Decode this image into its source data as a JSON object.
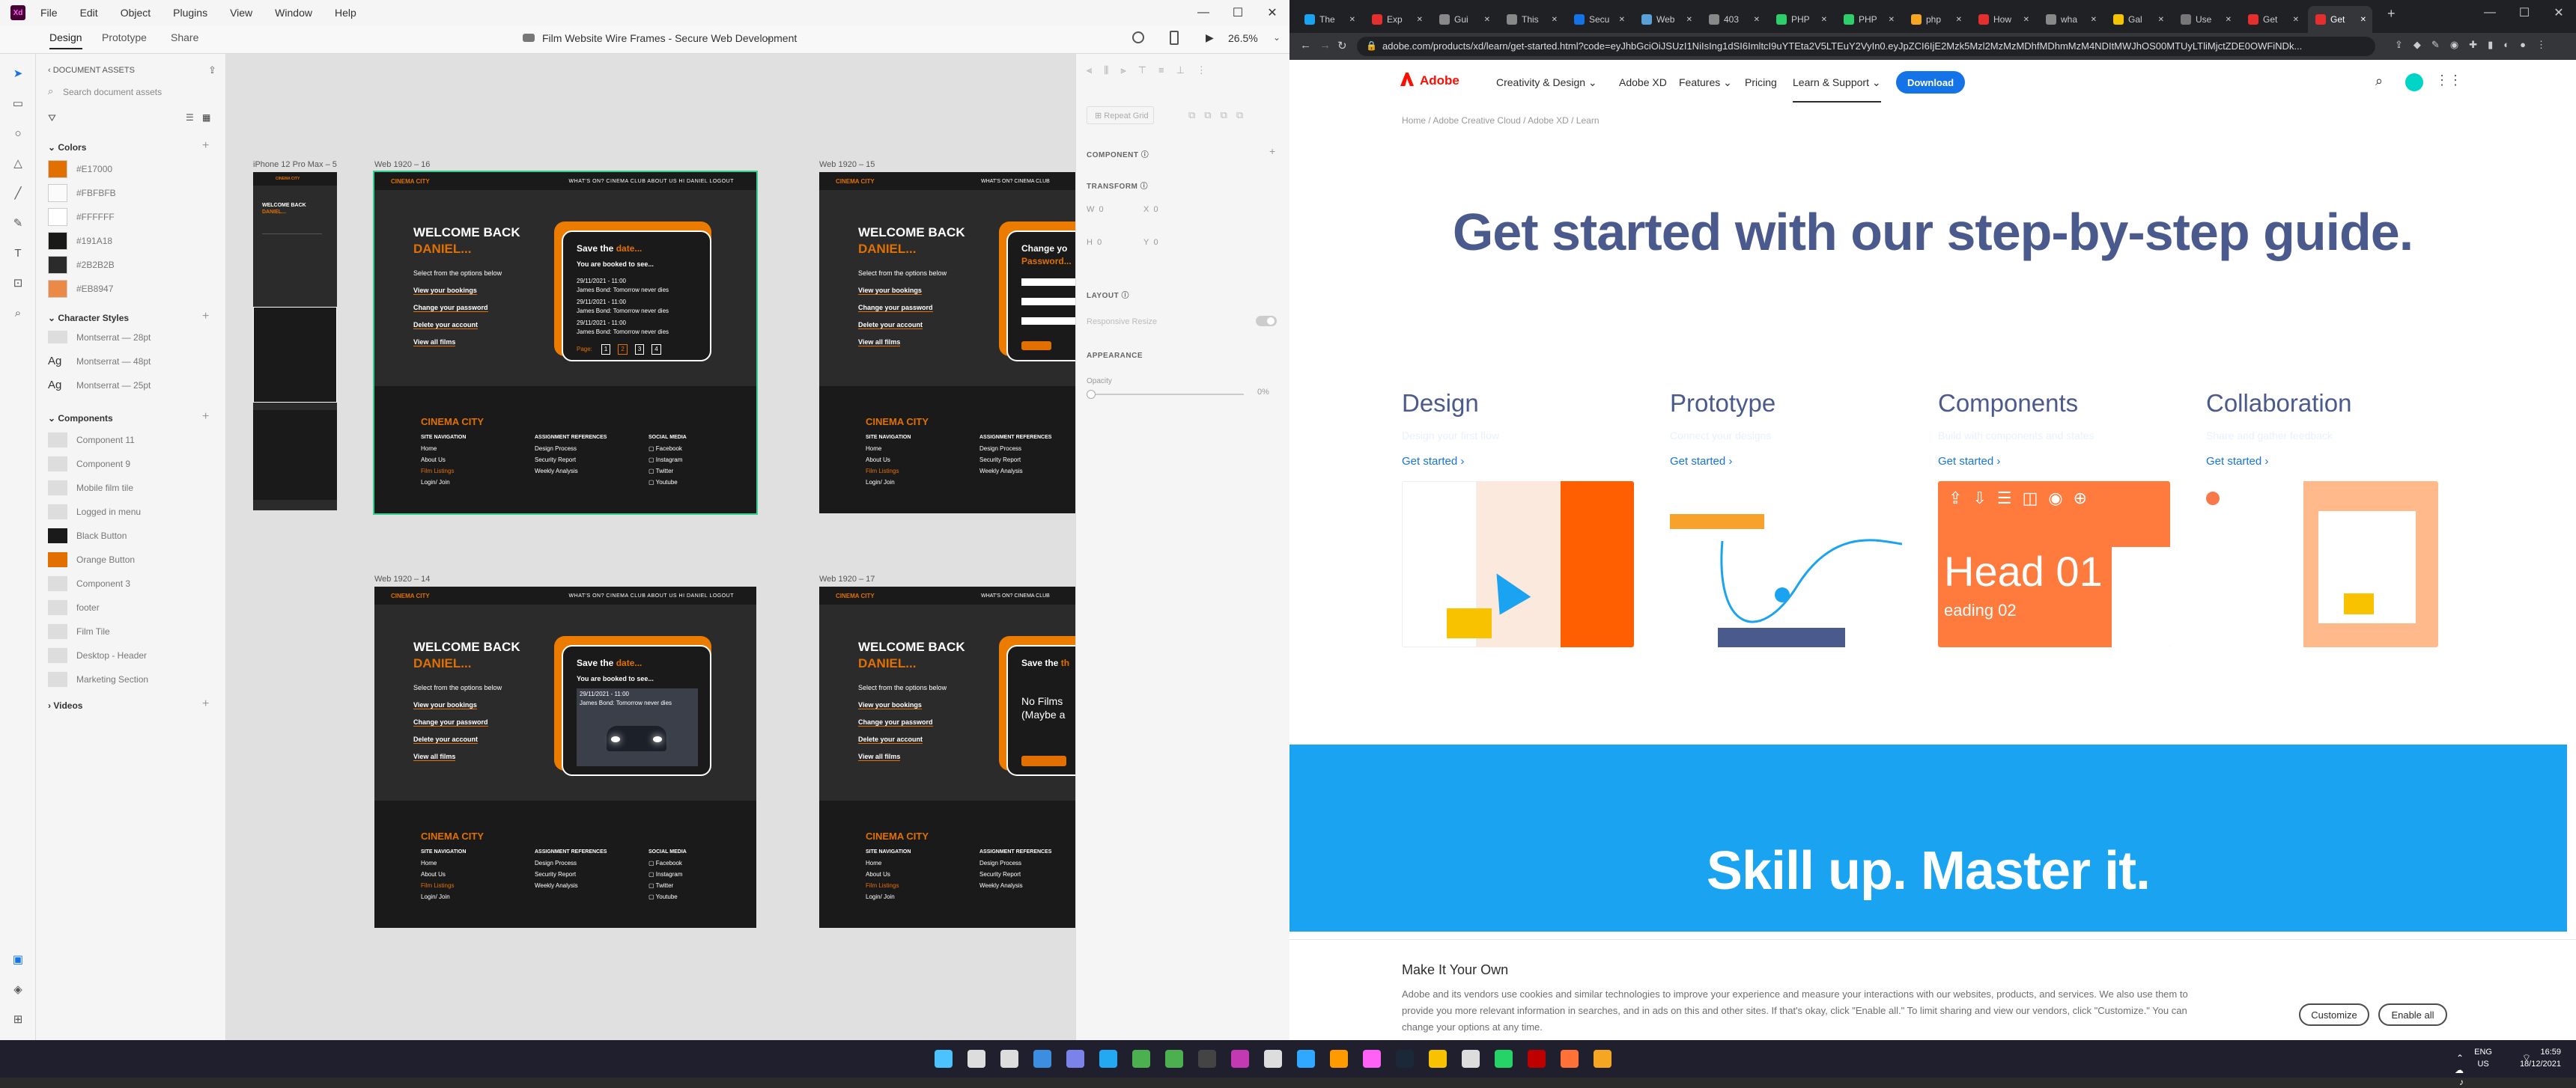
{
  "xd": {
    "menu": [
      "File",
      "Edit",
      "Object",
      "Plugins",
      "View",
      "Window",
      "Help"
    ],
    "tabs": {
      "design": "Design",
      "prototype": "Prototype",
      "share": "Share"
    },
    "doc_title": "Film Website Wire Frames - Secure Web Development",
    "zoom": "26.5%",
    "assets": {
      "header": "DOCUMENT ASSETS",
      "search_placeholder": "Search document assets",
      "colors_head": "Colors",
      "colors": [
        {
          "hex": "#E17000",
          "label": "#E17000"
        },
        {
          "hex": "#FBFBFB",
          "label": "#FBFBFB"
        },
        {
          "hex": "#FFFFFF",
          "label": "#FFFFFF"
        },
        {
          "hex": "#191A18",
          "label": "#191A18"
        },
        {
          "hex": "#2B2B2B",
          "label": "#2B2B2B"
        },
        {
          "hex": "#EB8947",
          "label": "#EB8947"
        }
      ],
      "char_head": "Character Styles",
      "char_styles": [
        "Montserrat — 28pt",
        "Montserrat — 48pt",
        "Montserrat — 25pt"
      ],
      "comp_head": "Components",
      "components": [
        "Component 11",
        "Component 9",
        "Mobile film tile",
        "Logged in menu",
        "Black Button",
        "Orange Button",
        "Component 3",
        "footer",
        "Film Tile",
        "Desktop - Header",
        "Marketing Section"
      ],
      "videos_head": "Videos"
    },
    "artboards": {
      "phone_label": "iPhone 12 Pro Max – 5",
      "ab16": "Web 1920 – 16",
      "ab15": "Web 1920 – 15",
      "ab14": "Web 1920 – 14",
      "ab17": "Web 1920 – 17",
      "logo": "CINEMA CITY",
      "nav_links": "WHAT'S ON?   CINEMA CLUB   ABOUT US   HI DANIEL   LOGOUT",
      "welcome": "WELCOME BACK",
      "name": "DANIEL...",
      "select": "Select from the options below",
      "links": [
        "View your bookings",
        "Change your password",
        "Delete your account",
        "View all films"
      ],
      "save_the": "Save the",
      "date": "date...",
      "booked": "You are booked to see...",
      "film1a": "29/11/2021 - 11:00",
      "film1b": "James Bond: Tomorrow never dies",
      "page": "Page:",
      "pages": [
        "1",
        "2",
        "3",
        "4"
      ],
      "change_pw": "Change yo",
      "password": "Password...",
      "no_films": "No Films",
      "maybe": "(Maybe a",
      "footer_title": "CINEMA CITY",
      "site_nav_head": "SITE NAVIGATION",
      "site_nav": [
        "Home",
        "About Us",
        "Film Listings",
        "Login/ Join"
      ],
      "assign_head": "ASSIGNMENT REFERENCES",
      "assign": [
        "Design Process",
        "Security Report",
        "Weekly Analysis"
      ],
      "social_head": "SOCIAL MEDIA",
      "social": [
        "Facebook",
        "Instagram",
        "Twitter",
        "Youtube"
      ]
    },
    "props": {
      "repeat_grid": "Repeat Grid",
      "component": "COMPONENT",
      "transform": "TRANSFORM",
      "w": "W",
      "w_val": "0",
      "x": "X",
      "x_val": "0",
      "h": "H",
      "h_val": "0",
      "y": "Y",
      "y_val": "0",
      "layout": "LAYOUT",
      "responsive": "Responsive Resize",
      "appearance": "APPEARANCE",
      "opacity": "Opacity",
      "opacity_val": "0%"
    }
  },
  "chrome": {
    "tabs": [
      "The",
      "Exp",
      "Gui",
      "This",
      "Secu",
      "Web",
      "403",
      "PHP",
      "PHP",
      "php",
      "How",
      "wha",
      "Gal",
      "Use",
      "Get",
      "Get"
    ],
    "url": "adobe.com/products/xd/learn/get-started.html?code=eyJhbGciOiJSUzI1NiIsIng1dSI6ImltcI9uYTEta2V5LTEuY2VyIn0.eyJpZCI6IjE2Mzk5Mzl2MzMzMDhfMDhmMzM4NDItMWJhOS00MTUyLTliMjctZDE0OWFiNDk..."
  },
  "adobe": {
    "brand": "Adobe",
    "nav": [
      "Creativity & Design",
      "Adobe XD",
      "Features",
      "Pricing",
      "Learn & Support"
    ],
    "download": "Download",
    "breadcrumb": "Home  /  Adobe Creative Cloud  /  Adobe XD  /  Learn",
    "headline": "Get started with our step-by-step guide.",
    "cards": [
      {
        "title": "Design",
        "desc": "Design your first flow",
        "cta": "Get started"
      },
      {
        "title": "Prototype",
        "desc": "Connect your designs",
        "cta": "Get started"
      },
      {
        "title": "Components",
        "desc": "Build with components and states",
        "cta": "Get started"
      },
      {
        "title": "Collaboration",
        "desc": "Share and gather feedback",
        "cta": "Get started"
      }
    ],
    "card3_head": "Head 01",
    "card3_sub": "eading 02",
    "skill": "Skill up. Master it.",
    "cookie": {
      "title": "Make It Your Own",
      "text": "Adobe and its vendors use cookies and similar technologies to improve your experience and measure your interactions with our websites, products, and services. We also use them to provide you more relevant information in searches, and in ads on this and other sites. If that's okay, click \"Enable all.\" To limit sharing and view our vendors, click \"Customize.\" You can change your options at any time.",
      "customize": "Customize",
      "enable": "Enable all"
    }
  },
  "taskbar": {
    "lang": "ENG",
    "region": "US",
    "time": "16:59",
    "date": "18/12/2021"
  }
}
